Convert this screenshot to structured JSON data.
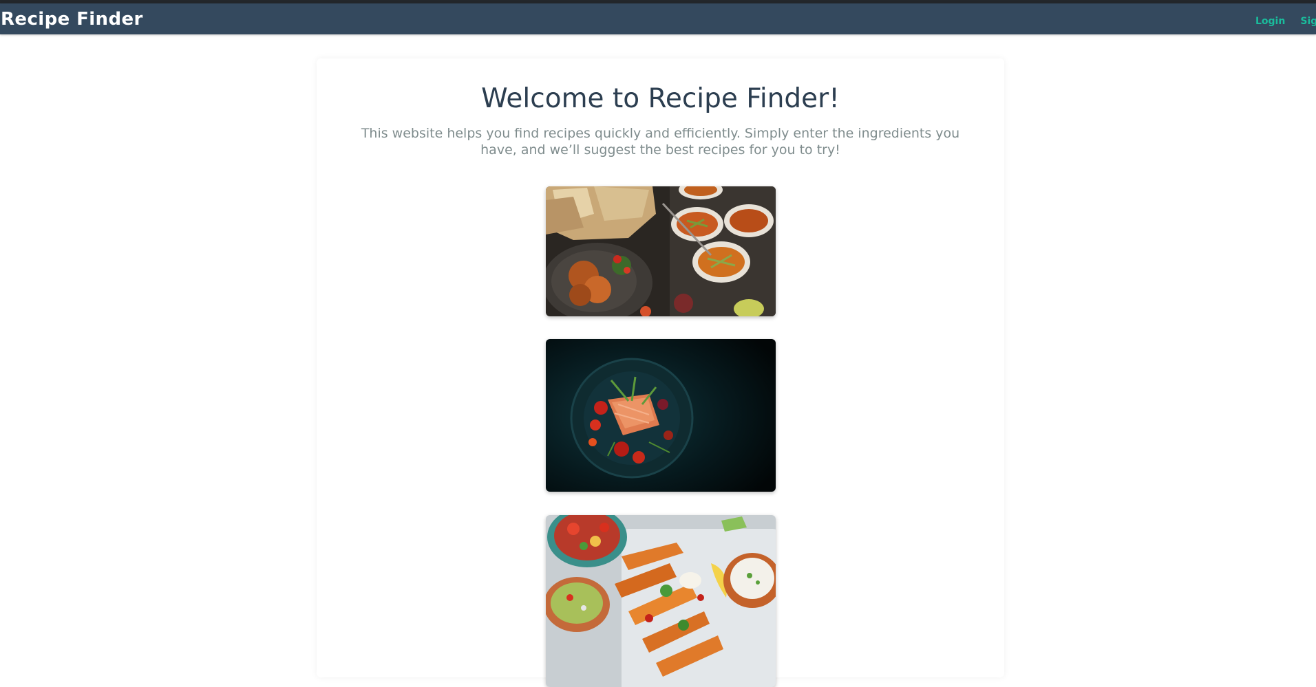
{
  "navbar": {
    "brand": "Recipe Finder",
    "links": [
      "Login",
      "Signup"
    ]
  },
  "main": {
    "title": "Welcome to Recipe Finder!",
    "description": "This website helps you find recipes quickly and efficiently. Simply enter the ingredients you have, and we’ll suggest the best recipes for you to try!"
  },
  "colors": {
    "navbar_bg": "#34495e",
    "link_accent": "#1abc9c",
    "title_text": "#2c3e50",
    "description_text": "#7f8c8d"
  },
  "images": [
    {
      "icon": "food-spread-photo"
    },
    {
      "icon": "salmon-dish-photo"
    },
    {
      "icon": "sweet-potato-salad-photo"
    }
  ]
}
